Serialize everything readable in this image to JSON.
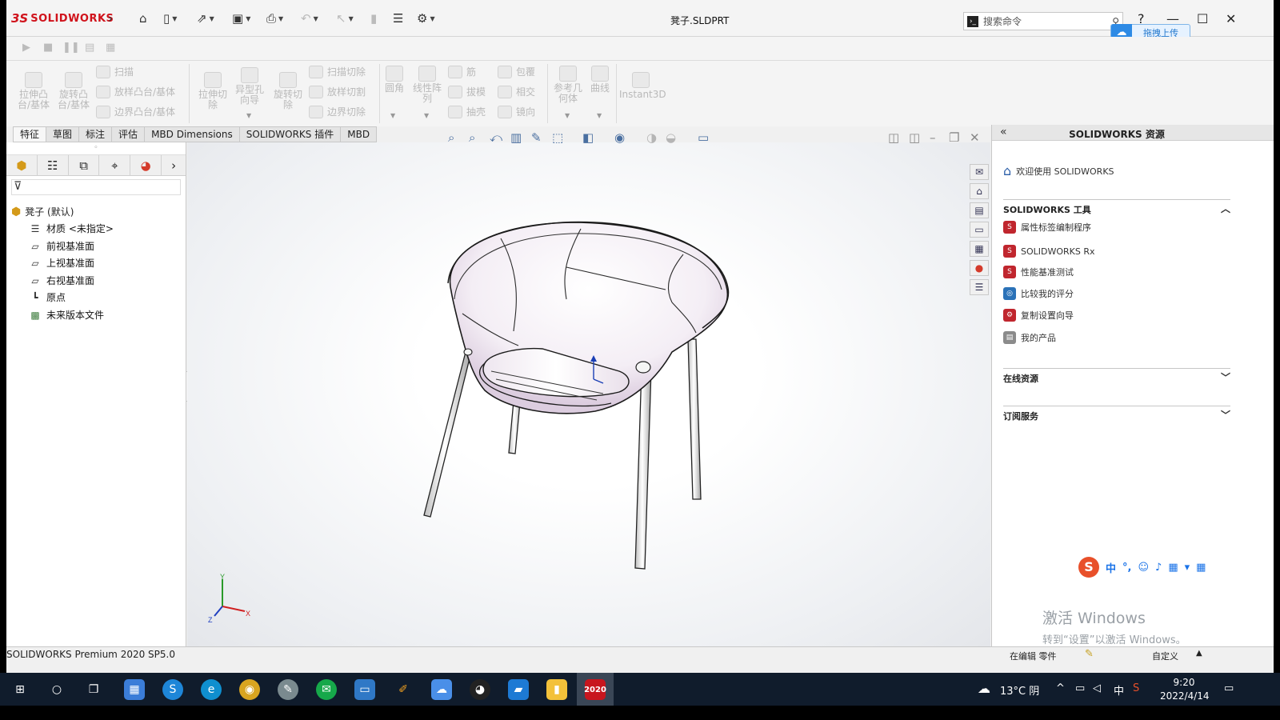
{
  "app": {
    "brand_mark": "3S",
    "brand": "SOLIDWORKS",
    "document_title": "凳子.SLDPRT",
    "search_placeholder": "搜索命令",
    "upload_label": "拖拽上传"
  },
  "command_manager": {
    "big_buttons": [
      {
        "label": "拉伸凸\n台/基体"
      },
      {
        "label": "旋转凸\n台/基体"
      },
      {
        "label": "拉伸切\n除"
      },
      {
        "label": "异型孔\n向导"
      },
      {
        "label": "旋转切\n除"
      },
      {
        "label": "圆角"
      },
      {
        "label": "线性阵\n列"
      },
      {
        "label": "参考几\n何体"
      },
      {
        "label": "曲线"
      },
      {
        "label": "Instant3D"
      }
    ],
    "small_buttons": [
      {
        "label": "扫描"
      },
      {
        "label": "放样凸台/基体"
      },
      {
        "label": "边界凸台/基体"
      },
      {
        "label": "扫描切除"
      },
      {
        "label": "放样切割"
      },
      {
        "label": "边界切除"
      },
      {
        "label": "筋"
      },
      {
        "label": "拔模"
      },
      {
        "label": "抽壳"
      },
      {
        "label": "包覆"
      },
      {
        "label": "相交"
      },
      {
        "label": "镜向"
      }
    ]
  },
  "tabs": [
    "特征",
    "草图",
    "标注",
    "评估",
    "MBD Dimensions",
    "SOLIDWORKS 插件",
    "MBD"
  ],
  "feature_tree": {
    "root": "凳子  (默认)",
    "items": [
      {
        "label": "材质 <未指定>",
        "icon": "material-icon"
      },
      {
        "label": "前视基准面",
        "icon": "plane-icon"
      },
      {
        "label": "上视基准面",
        "icon": "plane-icon"
      },
      {
        "label": "右视基准面",
        "icon": "plane-icon"
      },
      {
        "label": "原点",
        "icon": "origin-icon"
      },
      {
        "label": "未来版本文件",
        "icon": "future-version-icon"
      }
    ]
  },
  "triad": {
    "y": "Y",
    "x": "X",
    "z": "Z"
  },
  "resources_panel": {
    "title": "SOLIDWORKS 资源",
    "welcome": "欢迎使用 SOLIDWORKS",
    "tools_header": "SOLIDWORKS 工具",
    "tools": [
      {
        "label": "属性标签编制程序"
      },
      {
        "label": "SOLIDWORKS Rx"
      },
      {
        "label": "性能基准测试"
      },
      {
        "label": "比较我的评分"
      },
      {
        "label": "复制设置向导"
      },
      {
        "label": "我的产品"
      }
    ],
    "online_header": "在线资源",
    "subscription_header": "订阅服务"
  },
  "ime": {
    "mode": "中",
    "punct": "°,"
  },
  "watermark": {
    "line1": "激活 Windows",
    "line2": "转到“设置”以激活 Windows。"
  },
  "status_bar": {
    "version": "SOLIDWORKS Premium 2020 SP5.0",
    "state": "在编辑 零件",
    "custom": "自定义"
  },
  "taskbar": {
    "weather": "13°C  阴",
    "ime": "中",
    "time": "9:20",
    "date": "2022/4/14",
    "sw_badge": "2020"
  },
  "colors": {
    "brand_red": "#d0121b",
    "taskbar": "#101c2c",
    "accent_blue": "#2d8ae5"
  }
}
